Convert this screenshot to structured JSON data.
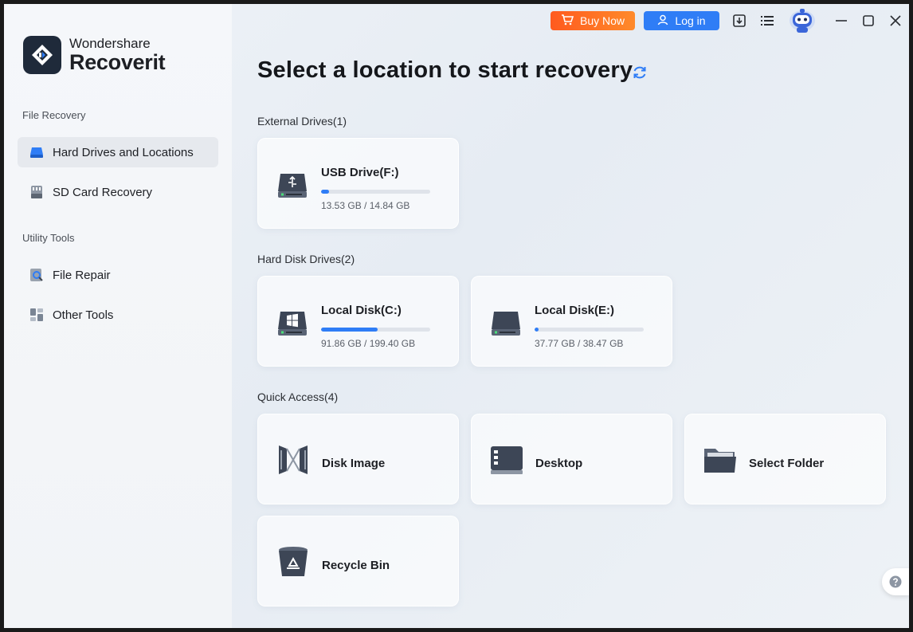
{
  "app": {
    "brand": "Wondershare",
    "product": "Recoverit"
  },
  "sidebar": {
    "sections": [
      {
        "label": "File Recovery",
        "items": [
          {
            "label": "Hard Drives and Locations",
            "icon": "hard-drive-icon",
            "active": true
          },
          {
            "label": "SD Card Recovery",
            "icon": "sd-card-icon",
            "active": false
          }
        ]
      },
      {
        "label": "Utility Tools",
        "items": [
          {
            "label": "File Repair",
            "icon": "file-repair-icon",
            "active": false
          },
          {
            "label": "Other Tools",
            "icon": "other-tools-icon",
            "active": false
          }
        ]
      }
    ]
  },
  "topbar": {
    "buy_label": "Buy Now",
    "login_label": "Log in"
  },
  "main": {
    "title": "Select a location to start recovery",
    "groups": {
      "external": {
        "label": "External Drives(1)",
        "drives": [
          {
            "name": "USB Drive(F:)",
            "size": "13.53 GB / 14.84 GB",
            "usage": 0.07
          }
        ]
      },
      "hard_disk": {
        "label": "Hard Disk Drives(2)",
        "drives": [
          {
            "name": "Local Disk(C:)",
            "size": "91.86 GB / 199.40 GB",
            "usage": 0.52
          },
          {
            "name": "Local Disk(E:)",
            "size": "37.77 GB / 38.47 GB",
            "usage": 0.04
          }
        ]
      },
      "quick_access": {
        "label": "Quick Access(4)",
        "items": [
          {
            "name": "Disk Image",
            "icon": "disk-image-icon"
          },
          {
            "name": "Desktop",
            "icon": "desktop-icon"
          },
          {
            "name": "Select Folder",
            "icon": "folder-icon"
          },
          {
            "name": "Recycle Bin",
            "icon": "recycle-bin-icon"
          }
        ]
      }
    }
  },
  "colors": {
    "accent": "#2f7df6",
    "buy": "#ff6a24",
    "sidebar_active": "#e6e9ee"
  }
}
